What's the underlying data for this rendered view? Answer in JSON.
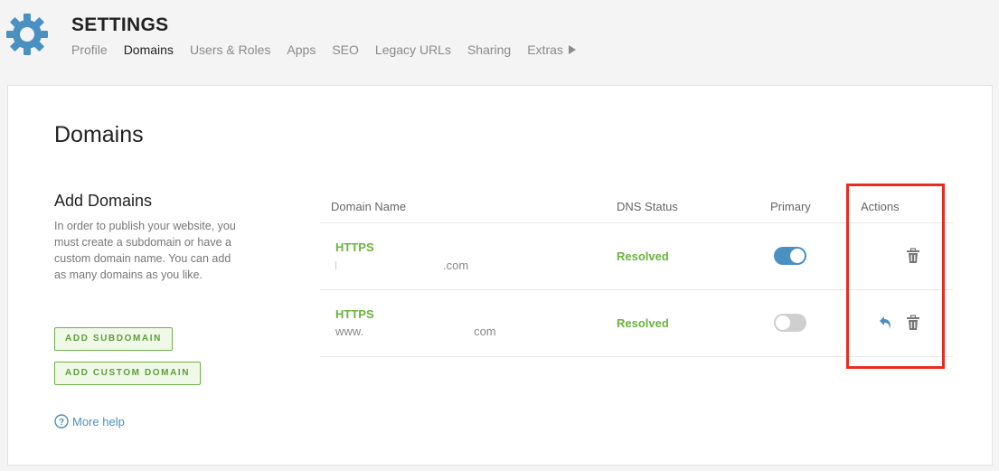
{
  "header": {
    "title": "SETTINGS",
    "nav": [
      {
        "label": "Profile",
        "active": false
      },
      {
        "label": "Domains",
        "active": true
      },
      {
        "label": "Users & Roles",
        "active": false
      },
      {
        "label": "Apps",
        "active": false
      },
      {
        "label": "SEO",
        "active": false
      },
      {
        "label": "Legacy URLs",
        "active": false
      },
      {
        "label": "Sharing",
        "active": false
      },
      {
        "label": "Extras",
        "active": false
      }
    ],
    "gear_color": "#4a90c2"
  },
  "page": {
    "title": "Domains"
  },
  "add_domains": {
    "title": "Add Domains",
    "description": "In order to publish your website, you must create a subdomain or have a custom domain name. You can add as many domains as you like.",
    "add_subdomain_label": "ADD SUBDOMAIN",
    "add_custom_domain_label": "ADD CUSTOM DOMAIN",
    "more_help_label": "More help"
  },
  "table": {
    "headers": {
      "domain_name": "Domain Name",
      "dns_status": "DNS Status",
      "primary": "Primary",
      "actions": "Actions"
    },
    "rows": [
      {
        "protocol": "HTTPS",
        "domain_prefix": "",
        "domain_suffix": ".com",
        "dns_status": "Resolved",
        "primary": true
      },
      {
        "protocol": "HTTPS",
        "domain_prefix": "www.",
        "domain_suffix": "com",
        "dns_status": "Resolved",
        "primary": false
      }
    ]
  },
  "colors": {
    "accent": "#4a90c2",
    "success": "#6bb33f",
    "highlight": "#ee2a1f"
  }
}
